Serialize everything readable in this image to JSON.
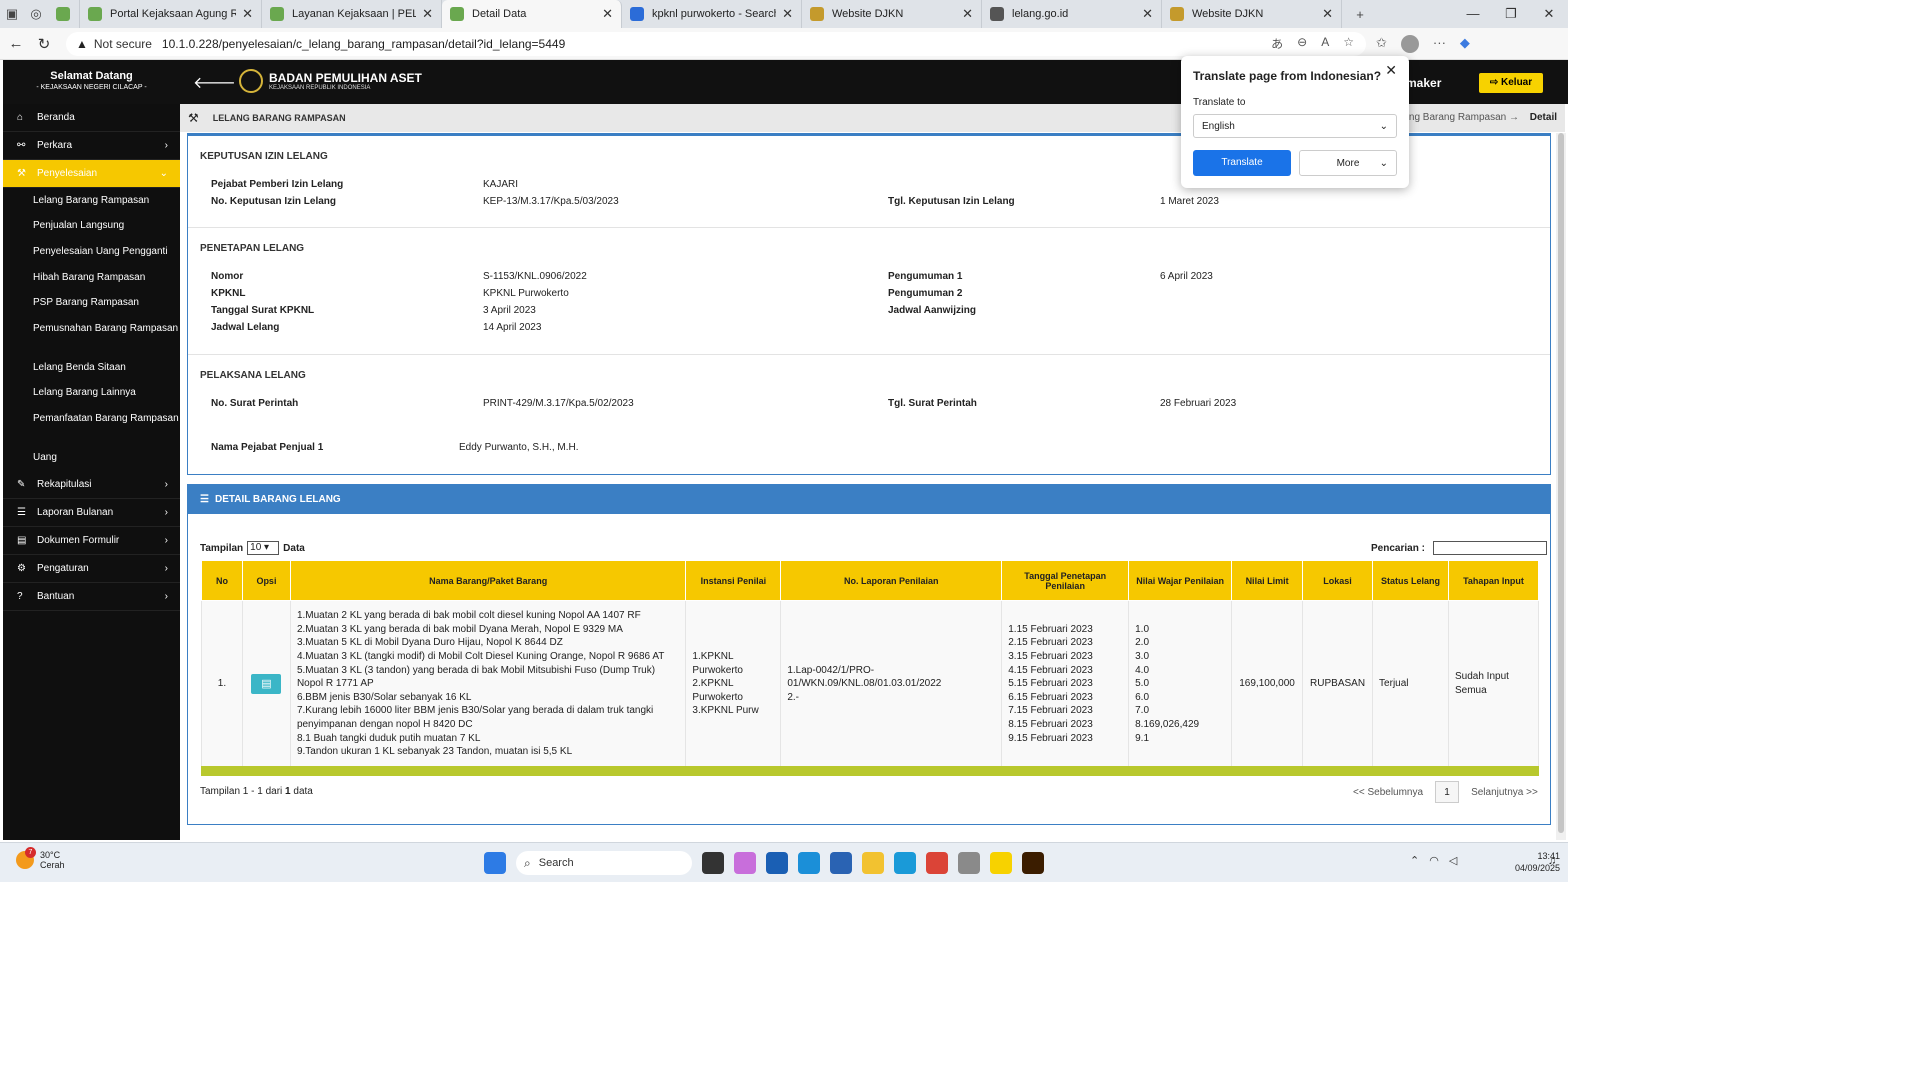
{
  "browser": {
    "tabs": [
      {
        "title": "Portal Kejaksaan Agung Repub",
        "color": "#6aa84f",
        "active": false
      },
      {
        "title": "Layanan Kejaksaan | PELAYANA",
        "color": "#6aa84f",
        "active": false
      },
      {
        "title": "Detail Data",
        "color": "#6aa84f",
        "active": true
      },
      {
        "title": "kpknl purwokerto - Search",
        "color": "#2b6cd8",
        "active": false
      },
      {
        "title": "Website DJKN",
        "color": "#c49a2c",
        "active": false
      },
      {
        "title": "lelang.go.id",
        "color": "#555555",
        "active": false
      },
      {
        "title": "Website DJKN",
        "color": "#c49a2c",
        "active": false
      }
    ],
    "not_secure": "Not secure",
    "url": "10.1.0.228/penyelesaian/c_lelang_barang_rampasan/detail?id_lelang=5449"
  },
  "header": {
    "welcome": "Selamat Datang",
    "office": "- KEJAKSAAN NEGERI CILACAP -",
    "logo_title": "BADAN PEMULIHAN ASET",
    "logo_sub": "KEJAKSAAN REPUBLIK INDONESIA",
    "user": "maker",
    "logout": "Keluar"
  },
  "sidebar": {
    "items": [
      {
        "label": "Beranda",
        "icon": "home-icon"
      },
      {
        "label": "Perkara",
        "icon": "link-icon"
      },
      {
        "label": "Penyelesaian",
        "icon": "gavel-icon"
      }
    ],
    "subitems": [
      "Lelang Barang Rampasan",
      "Penjualan Langsung",
      "Penyelesaian Uang Pengganti",
      "Hibah Barang Rampasan",
      "PSP Barang Rampasan",
      "Pemusnahan Barang Rampasan",
      "Lelang Benda Sitaan",
      "Lelang Barang Lainnya",
      "Pemanfaatan Barang Rampasan",
      "Uang"
    ],
    "items2": [
      {
        "label": "Rekapitulasi",
        "icon": "edit-icon"
      },
      {
        "label": "Laporan Bulanan",
        "icon": "list-icon"
      },
      {
        "label": "Dokumen Formulir",
        "icon": "file-icon"
      },
      {
        "label": "Pengaturan",
        "icon": "gear-icon"
      },
      {
        "label": "Bantuan",
        "icon": "question-icon"
      }
    ]
  },
  "breadcrumb": {
    "title": "LELANG BARANG RAMPASAN",
    "path": "Lelang Barang Rampasan",
    "current": "Detail"
  },
  "izin": {
    "section": "KEPUTUSAN IZIN LELANG",
    "pejabat_label": "Pejabat Pemberi Izin Lelang",
    "pejabat": "KAJARI",
    "no_label": "No. Keputusan Izin Lelang",
    "no": "KEP-13/M.3.17/Kpa.5/03/2023",
    "tgl_label": "Tgl. Keputusan Izin Lelang",
    "tgl": "1 Maret 2023"
  },
  "penetapan": {
    "section": "PENETAPAN LELANG",
    "nomor_label": "Nomor",
    "nomor": "S-1153/KNL.0906/2022",
    "kpknl_label": "KPKNL",
    "kpknl": "KPKNL Purwokerto",
    "tgl_surat_label": "Tanggal Surat KPKNL",
    "tgl_surat": "3 April 2023",
    "jadwal_label": "Jadwal Lelang",
    "jadwal": "14 April 2023",
    "peng1_label": "Pengumuman 1",
    "peng1": "6 April 2023",
    "peng2_label": "Pengumuman 2",
    "aanwijzing_label": "Jadwal Aanwijzing"
  },
  "pelaksana": {
    "section": "PELAKSANA LELANG",
    "no_label": "No. Surat Perintah",
    "no": "PRINT-429/M.3.17/Kpa.5/02/2023",
    "tgl_label": "Tgl. Surat Perintah",
    "tgl": "28 Februari 2023",
    "pejabat_label": "Nama Pejabat Penjual 1",
    "pejabat": "Eddy Purwanto, S.H., M.H."
  },
  "detail": {
    "title": "DETAIL BARANG LELANG",
    "show_label": "Tampilan",
    "show_value": "10",
    "show_suffix": "Data",
    "search_label": "Pencarian :",
    "columns": [
      "No",
      "Opsi",
      "Nama Barang/Paket Barang",
      "Instansi Penilai",
      "No. Laporan Penilaian",
      "Tanggal Penetapan Penilaian",
      "Nilai Wajar Penilaian",
      "Nilai Limit",
      "Lokasi",
      "Status Lelang",
      "Tahapan Input"
    ],
    "row": {
      "no": "1.",
      "barang": [
        "1.Muatan 2 KL yang berada di bak mobil colt diesel kuning Nopol AA 1407 RF",
        "2.Muatan 3 KL yang berada di bak mobil Dyana Merah, Nopol E 9329 MA",
        "3.Muatan 5 KL di Mobil Dyana Duro Hijau, Nopol K 8644 DZ",
        "4.Muatan 3 KL (tangki modif) di Mobil Colt Diesel Kuning Orange, Nopol R 9686 AT",
        "5.Muatan 3 KL (3 tandon) yang berada di bak Mobil Mitsubishi Fuso (Dump Truk) Nopol R 1771 AP",
        "6.BBM jenis B30/Solar sebanyak 16 KL",
        "7.Kurang lebih 16000 liter BBM jenis B30/Solar yang berada di dalam truk tangki penyimpanan dengan nopol H 8420 DC",
        "8.1 Buah tangki duduk putih muatan 7 KL",
        "9.Tandon ukuran 1 KL sebanyak 23 Tandon, muatan isi 5,5 KL"
      ],
      "instansi": [
        "1.KPKNL Purwokerto",
        "2.KPKNL Purwokerto",
        "3.KPKNL Purw"
      ],
      "laporan": [
        "1.Lap-0042/1/PRO-01/WKN.09/KNL.08/01.03.01/2022",
        "2.-"
      ],
      "tanggal": [
        "1.15 Februari 2023",
        "2.15 Februari 2023",
        "3.15 Februari 2023",
        "4.15 Februari 2023",
        "5.15 Februari 2023",
        "6.15 Februari 2023",
        "7.15 Februari 2023",
        "8.15 Februari 2023",
        "9.15 Februari 2023"
      ],
      "nilai_wajar": [
        "1.0",
        "2.0",
        "3.0",
        "4.0",
        "5.0",
        "6.0",
        "7.0",
        "8.169,026,429",
        "9.1"
      ],
      "limit": "169,100,000",
      "lokasi": "RUPBASAN",
      "status": "Terjual",
      "tahapan": "Sudah Input Semua"
    },
    "footer_prefix": "Tampilan 1 - 1 dari",
    "footer_total": "1",
    "footer_suffix": "data",
    "prev": "<< Sebelumnya",
    "page": "1",
    "next": "Selanjutnya >>"
  },
  "translate": {
    "title": "Translate page from Indonesian?",
    "to_label": "Translate to",
    "language": "English",
    "translate_btn": "Translate",
    "more_btn": "More"
  },
  "taskbar": {
    "temp": "30°C",
    "weather": "Cerah",
    "badge": "7",
    "search": "Search",
    "time": "13:41",
    "date": "04/09/2025"
  }
}
